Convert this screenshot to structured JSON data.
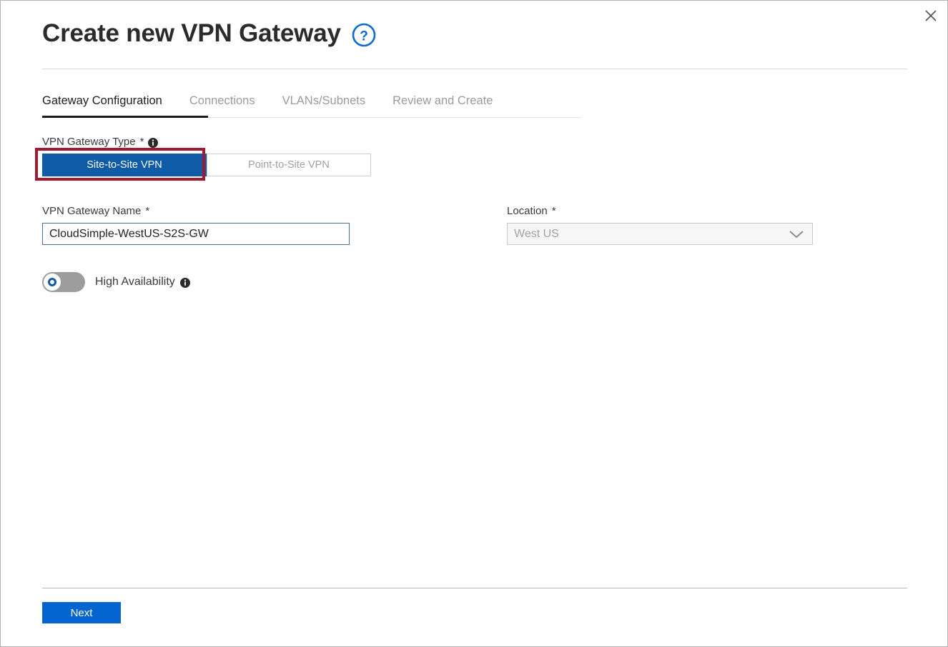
{
  "window": {
    "title": "Create new VPN Gateway",
    "help_icon": "help-circle-icon",
    "close_icon": "close-icon"
  },
  "tabs": [
    {
      "label": "Gateway Configuration",
      "active": true
    },
    {
      "label": "Connections",
      "active": false
    },
    {
      "label": "VLANs/Subnets",
      "active": false
    },
    {
      "label": "Review and Create",
      "active": false
    }
  ],
  "form": {
    "gateway_type": {
      "label": "VPN Gateway Type",
      "required_marker": "*",
      "info_icon": "info-icon",
      "options": [
        {
          "label": "Site-to-Site VPN",
          "selected": true
        },
        {
          "label": "Point-to-Site VPN",
          "selected": false
        }
      ],
      "highlight_color": "#9e1b32",
      "selected_color": "#0f5ba8"
    },
    "gateway_name": {
      "label": "VPN Gateway Name",
      "required_marker": "*",
      "value": "CloudSimple-WestUS-S2S-GW",
      "placeholder": "Enter gateway name"
    },
    "location": {
      "label": "Location",
      "required_marker": "*",
      "value": "West US",
      "chevron_icon": "chevron-down-icon"
    },
    "high_availability": {
      "label": "High Availability",
      "info_icon": "info-icon",
      "state": "off"
    }
  },
  "footer": {
    "next_label": "Next",
    "next_color": "#0565d0"
  }
}
